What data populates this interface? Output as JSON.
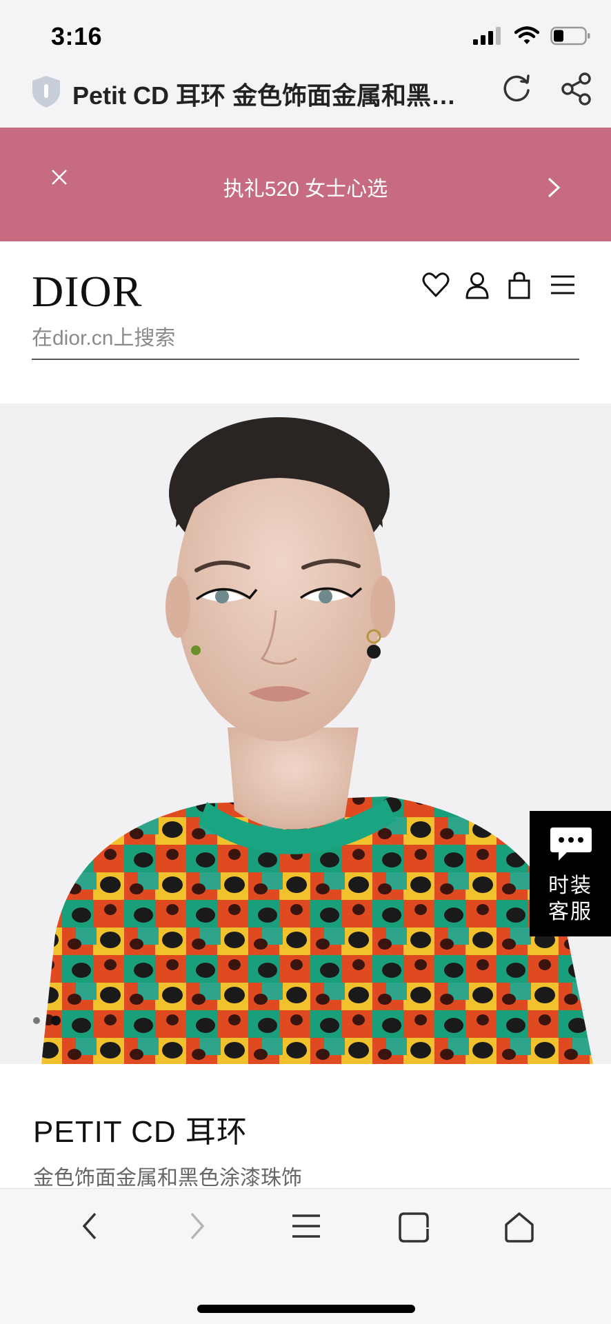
{
  "status_bar": {
    "time": "3:16"
  },
  "browser": {
    "page_title": "Petit CD 耳环 金色饰面金属和黑…"
  },
  "promo_banner": {
    "text": "执礼520 女士心选",
    "background_color": "#c66b80"
  },
  "header": {
    "logo": "DIOR",
    "icons": [
      "heart-icon",
      "account-icon",
      "bag-icon",
      "menu-icon"
    ],
    "search_placeholder": "在dior.cn上搜索"
  },
  "product_image": {
    "carousel_total": 2,
    "carousel_active": 2
  },
  "chat_widget": {
    "label_line1": "时装",
    "label_line2": "客服"
  },
  "product": {
    "name": "PETIT CD 耳环",
    "description": "金色饰面金属和黑色涂漆珠饰"
  },
  "toolbar": {
    "icons": [
      "back-icon",
      "forward-icon",
      "menu-icon",
      "tabs-icon",
      "home-icon"
    ]
  }
}
